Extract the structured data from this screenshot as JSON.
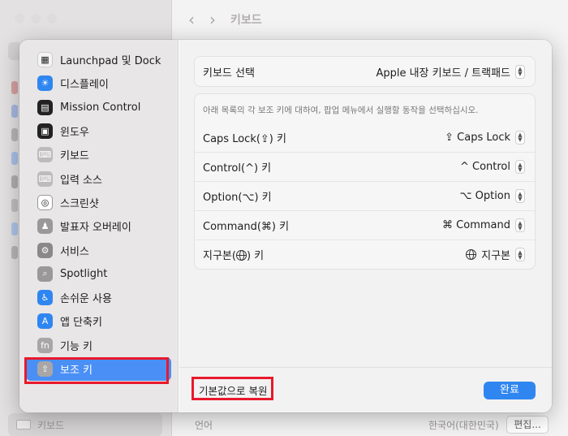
{
  "background": {
    "title": "키보드",
    "sidebar_bottom_label": "키보드",
    "language_label": "언어",
    "language_value": "한국어(대한민국)",
    "edit_button": "편집..."
  },
  "sidebar": {
    "items": [
      {
        "label": "Launchpad 및 Dock",
        "icon": "launchpad-icon"
      },
      {
        "label": "디스플레이",
        "icon": "display-icon"
      },
      {
        "label": "Mission Control",
        "icon": "mission-control-icon"
      },
      {
        "label": "윈도우",
        "icon": "window-icon"
      },
      {
        "label": "키보드",
        "icon": "keyboard-icon"
      },
      {
        "label": "입력 소스",
        "icon": "input-sources-icon"
      },
      {
        "label": "스크린샷",
        "icon": "screenshot-icon"
      },
      {
        "label": "발표자 오버레이",
        "icon": "presenter-overlay-icon"
      },
      {
        "label": "서비스",
        "icon": "services-icon"
      },
      {
        "label": "Spotlight",
        "icon": "spotlight-icon"
      },
      {
        "label": "손쉬운 사용",
        "icon": "accessibility-icon"
      },
      {
        "label": "앱 단축키",
        "icon": "app-shortcuts-icon"
      },
      {
        "label": "기능 키",
        "icon": "function-keys-icon",
        "glyph": "fn"
      },
      {
        "label": "보조 키",
        "icon": "modifier-keys-icon",
        "selected": true
      }
    ]
  },
  "keyboard_select": {
    "label": "키보드 선택",
    "value": "Apple 내장 키보드 / 트랙패드"
  },
  "description": "아래 목록의 각 보조 키에 대하여, 팝업 메뉴에서 실행할 동작을 선택하십시오.",
  "modifiers": [
    {
      "label": "Caps Lock(⇪) 키",
      "value": "⇪ Caps Lock"
    },
    {
      "label": "Control(^) 키",
      "value": "^ Control"
    },
    {
      "label": "Option(⌥) 키",
      "value": "⌥ Option"
    },
    {
      "label": "Command(⌘) 키",
      "value": "⌘ Command"
    },
    {
      "label": "지구본(",
      "label_after": ") 키",
      "value": "지구본",
      "has_globe": true
    }
  ],
  "footer": {
    "reset_label": "기본값으로 복원",
    "done_label": "완료"
  },
  "colors": {
    "accent": "#2f86f0",
    "selected_row": "#4a8ff5",
    "highlight_box": "#e8192c"
  }
}
